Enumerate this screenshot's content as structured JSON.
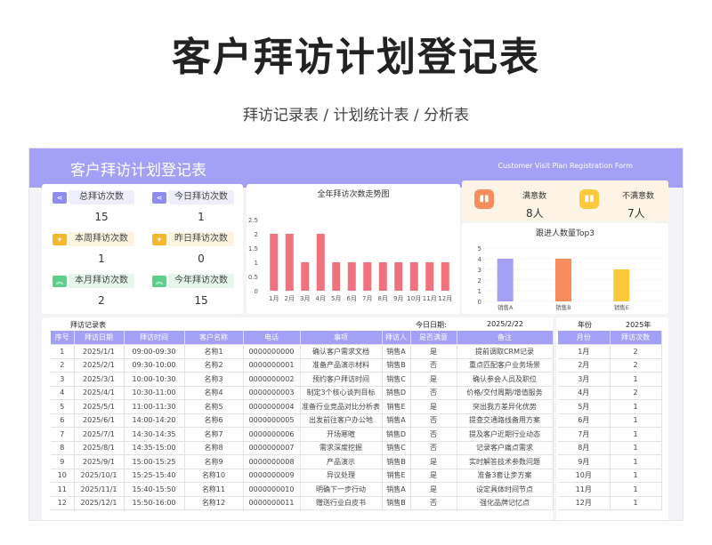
{
  "header": {
    "title": "客户拜访计划登记表",
    "subtitle": "拜访记录表 / 计划统计表 / 分析表"
  },
  "banner": {
    "title": "客户拜访计划登记表",
    "subtitle_en": "Customer Visit Plan Registration Form"
  },
  "kpis": [
    {
      "label": "总拜访次数",
      "value": "15",
      "color": "#8f8cf0",
      "bg": "#eeeefc",
      "icon": "share-icon"
    },
    {
      "label": "今日拜访次数",
      "value": "1",
      "color": "#8f8cf0",
      "bg": "#eeeefc",
      "icon": "share-icon"
    },
    {
      "label": "本周拜访次数",
      "value": "1",
      "color": "#f5b632",
      "bg": "#fdf4e0",
      "icon": "chevron-down-icon"
    },
    {
      "label": "昨日拜访次数",
      "value": "0",
      "color": "#f5b632",
      "bg": "#fdf4e0",
      "icon": "chevron-down-icon"
    },
    {
      "label": "本月拜访次数",
      "value": "2",
      "color": "#5fce8c",
      "bg": "#e6f7ee",
      "icon": "chevrons-up-icon"
    },
    {
      "label": "今年拜访次数",
      "value": "15",
      "color": "#5fce8c",
      "bg": "#e6f7ee",
      "icon": "chevrons-up-icon"
    }
  ],
  "satisfaction": {
    "satisfied_label": "满意数",
    "satisfied_value": "8人",
    "unsatisfied_label": "不满意数",
    "unsatisfied_value": "7人"
  },
  "chart_data": [
    {
      "type": "bar",
      "title": "全年拜访次数走势图",
      "categories": [
        "1月",
        "2月",
        "3月",
        "4月",
        "5月",
        "6月",
        "7月",
        "8月",
        "9月",
        "10月",
        "11月",
        "12月"
      ],
      "values": [
        2,
        2,
        1,
        2,
        1,
        1,
        1,
        1,
        1,
        1,
        1,
        1
      ],
      "ylim": [
        0,
        2.5
      ],
      "yticks": [
        "0",
        "0.5",
        "1",
        "1.5",
        "2",
        "2.5"
      ],
      "color": "#f0727f"
    },
    {
      "type": "bar",
      "title": "跟进人数量Top3",
      "categories": [
        "销售A",
        "销售B",
        "销售E"
      ],
      "values": [
        4,
        4,
        3
      ],
      "colors": [
        "#a3a1f7",
        "#f78c5c",
        "#fcc93c"
      ],
      "ylim": [
        0,
        5
      ],
      "yticks": [
        "0",
        "1",
        "2",
        "3",
        "4",
        "5"
      ]
    }
  ],
  "records": {
    "section_label": "拜访记录表",
    "today_label": "今日日期:",
    "today_value": "2025/2/22",
    "columns": [
      "序号",
      "拜访日期",
      "拜访时间",
      "客户名称",
      "电话",
      "事项",
      "拜访人",
      "是否满意",
      "备注"
    ],
    "rows": [
      [
        "1",
        "2025/1/1",
        "09:00-09:30",
        "名称1",
        "0000000000",
        "确认客户需求文档",
        "销售A",
        "是",
        "提前调取CRM记录"
      ],
      [
        "2",
        "2025/2/1",
        "09:30-10:00",
        "名称2",
        "0000000001",
        "准备产品演示材料",
        "销售B",
        "否",
        "重点匹配客户业务场景"
      ],
      [
        "3",
        "2025/3/1",
        "10:00-10:30",
        "名称3",
        "0000000002",
        "预约客户拜访时间",
        "销售C",
        "是",
        "确认参会人员及职位"
      ],
      [
        "4",
        "2025/4/1",
        "10:30-11:00",
        "名称4",
        "0000000003",
        "制定3个核心谈判目标",
        "销售D",
        "否",
        "价格/交付周期/增值服务"
      ],
      [
        "5",
        "2025/5/1",
        "11:00-11:30",
        "名称5",
        "0000000004",
        "准备行业竞品对比分析表",
        "销售E",
        "是",
        "突出我方差异化优势"
      ],
      [
        "6",
        "2025/6/1",
        "14:00-14:20",
        "名称6",
        "0000000005",
        "出发前往客户办公地",
        "销售A",
        "否",
        "提查交通路线备用方案"
      ],
      [
        "7",
        "2025/7/1",
        "14:30-14:35",
        "名称7",
        "0000000006",
        "开场寒暄",
        "销售D",
        "否",
        "提及客户近期行业动态"
      ],
      [
        "8",
        "2025/8/1",
        "14:35-15:00",
        "名称8",
        "0000000007",
        "需求深度挖掘",
        "销售C",
        "否",
        "记录客户痛点需求"
      ],
      [
        "9",
        "2025/9/1",
        "15:00-15:25",
        "名称9",
        "0000000008",
        "产品演示",
        "销售B",
        "是",
        "实时解答技术参数问题"
      ],
      [
        "10",
        "2025/10/1",
        "15:25-15:40",
        "名称10",
        "0000000009",
        "异议处理",
        "销售E",
        "是",
        "准备3套让步方案"
      ],
      [
        "11",
        "2025/11/1",
        "15:40-15:50",
        "名称11",
        "0000000010",
        "明确下一步行动",
        "销售A",
        "是",
        "设定具体时间节点"
      ],
      [
        "12",
        "2025/12/1",
        "15:50-16:00",
        "名称12",
        "0000000011",
        "赠送行业白皮书",
        "销售B",
        "否",
        "强化品牌记忆点"
      ]
    ]
  },
  "monthly": {
    "year_label": "年份",
    "year_value": "2025年",
    "columns": [
      "月份",
      "拜访次数"
    ],
    "rows": [
      [
        "1月",
        "2"
      ],
      [
        "2月",
        "2"
      ],
      [
        "3月",
        "1"
      ],
      [
        "4月",
        "2"
      ],
      [
        "5月",
        "1"
      ],
      [
        "6月",
        "1"
      ],
      [
        "7月",
        "1"
      ],
      [
        "8月",
        "1"
      ],
      [
        "9月",
        "1"
      ],
      [
        "10月",
        "1"
      ],
      [
        "11月",
        "1"
      ],
      [
        "12月",
        "1"
      ]
    ]
  }
}
